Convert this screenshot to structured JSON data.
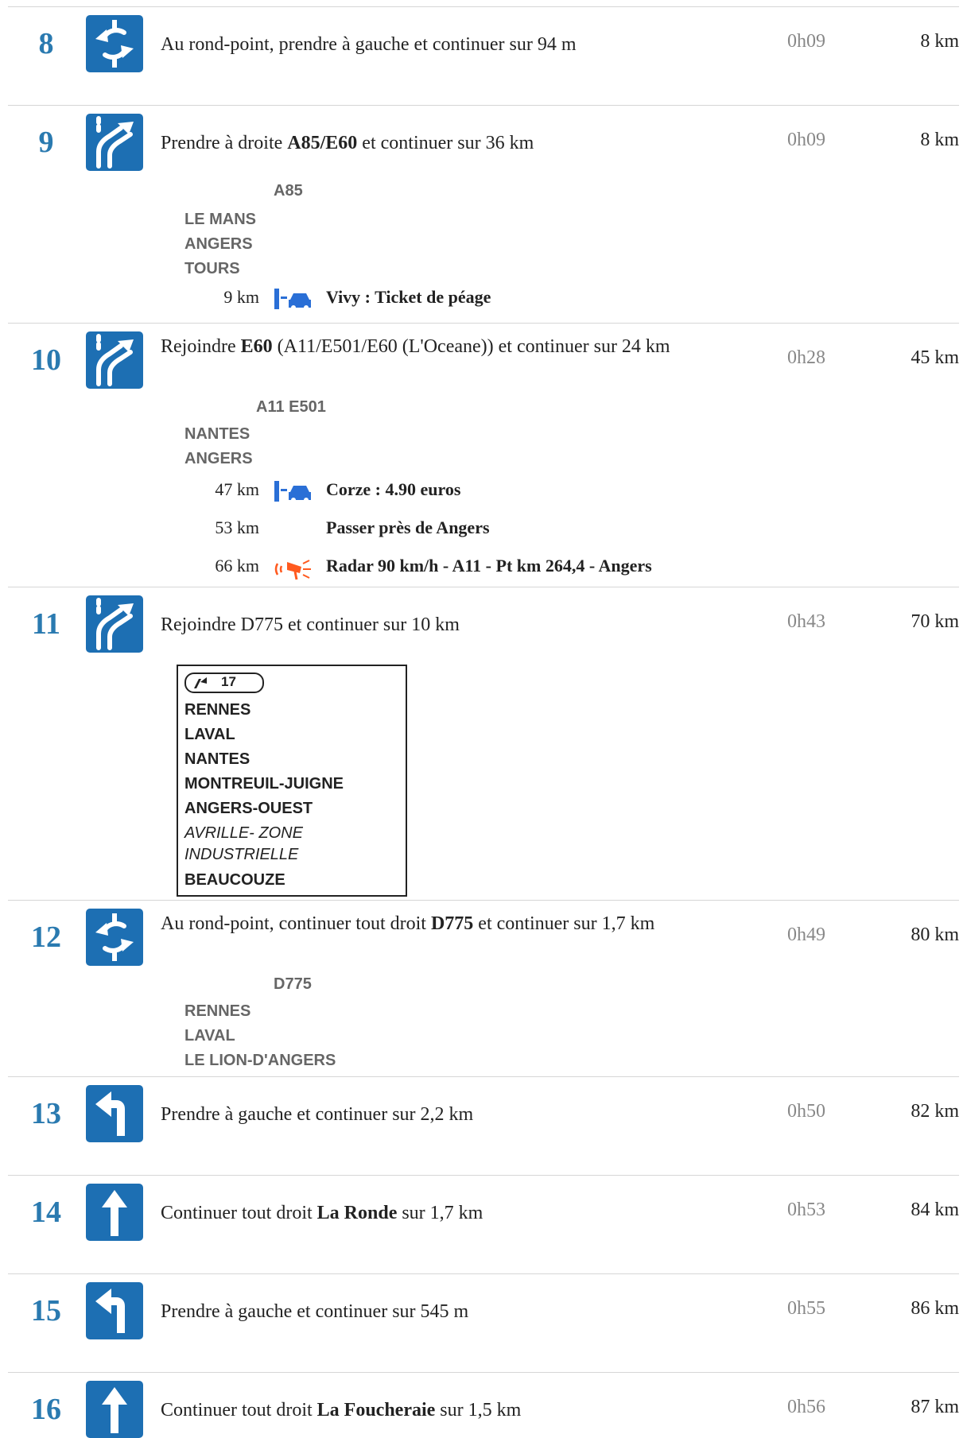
{
  "steps": [
    {
      "num": "8",
      "icon": "roundabout-icon",
      "pre": "Au rond-point, prendre à gauche et continuer sur 94 m",
      "bold": "",
      "post": "",
      "time": "0h09",
      "dist": "8 km"
    },
    {
      "num": "9",
      "icon": "keep-right-icon",
      "pre": "Prendre à droite ",
      "bold": "A85/E60",
      "post": " et continuer sur 36 km",
      "time": "0h09",
      "dist": "8 km"
    },
    {
      "num": "10",
      "icon": "keep-right-icon",
      "pre": "Rejoindre ",
      "bold": "E60",
      "post": " (A11/E501/E60 (L'Oceane)) et continuer sur 24 km",
      "time": "0h28",
      "dist": "45 km"
    },
    {
      "num": "11",
      "icon": "keep-right-icon",
      "pre": "Rejoindre D775 et continuer sur 10 km",
      "bold": "",
      "post": "",
      "time": "0h43",
      "dist": "70 km"
    },
    {
      "num": "12",
      "icon": "roundabout-icon",
      "pre": "Au rond-point, continuer tout droit ",
      "bold": "D775",
      "post": " et continuer sur 1,7 km",
      "time": "0h49",
      "dist": "80 km"
    },
    {
      "num": "13",
      "icon": "turn-left-icon",
      "pre": "Prendre à gauche et continuer sur 2,2 km",
      "bold": "",
      "post": "",
      "time": "0h50",
      "dist": "82 km"
    },
    {
      "num": "14",
      "icon": "straight-arrow-icon",
      "pre": "Continuer tout droit ",
      "bold": "La Ronde",
      "post": " sur 1,7 km",
      "time": "0h53",
      "dist": "84 km"
    },
    {
      "num": "15",
      "icon": "turn-left-icon",
      "pre": "Prendre à gauche et continuer sur 545 m",
      "bold": "",
      "post": "",
      "time": "0h55",
      "dist": "86 km"
    },
    {
      "num": "16",
      "icon": "straight-arrow-icon",
      "pre": "Continuer tout droit ",
      "bold": "La Foucheraie",
      "post": " sur 1,5 km",
      "time": "0h56",
      "dist": "87 km"
    }
  ],
  "sign9": {
    "road": "A85",
    "dests": [
      "LE MANS",
      "ANGERS",
      "TOURS"
    ]
  },
  "sub9": [
    {
      "km": "9 km",
      "icon": "toll-icon",
      "text": "Vivy : Ticket de péage"
    }
  ],
  "sign10": {
    "road": "A11 E501",
    "dests": [
      "NANTES",
      "ANGERS"
    ]
  },
  "sub10": [
    {
      "km": "47 km",
      "icon": "toll-icon",
      "text": "Corze : 4.90 euros"
    },
    {
      "km": "53 km",
      "icon": "",
      "text": "Passer près de Angers"
    },
    {
      "km": "66 km",
      "icon": "speed-camera-icon",
      "text": "Radar 90 km/h - A11 - Pt km 264,4 - Angers"
    }
  ],
  "sign11": {
    "exit": "17",
    "lines": [
      "RENNES",
      "LAVAL",
      "NANTES",
      "MONTREUIL-JUIGNE",
      "ANGERS-OUEST"
    ],
    "italic": [
      "AVRILLE- ZONE",
      "INDUSTRIELLE"
    ],
    "last": "BEAUCOUZE"
  },
  "sign12": {
    "road": "D775",
    "dests": [
      "RENNES",
      "LAVAL",
      "LE LION-D'ANGERS"
    ]
  },
  "colors": {
    "accent": "#2a7ab0",
    "icon_bg": "#1d6fb3",
    "radar": "#ff5a1f"
  }
}
